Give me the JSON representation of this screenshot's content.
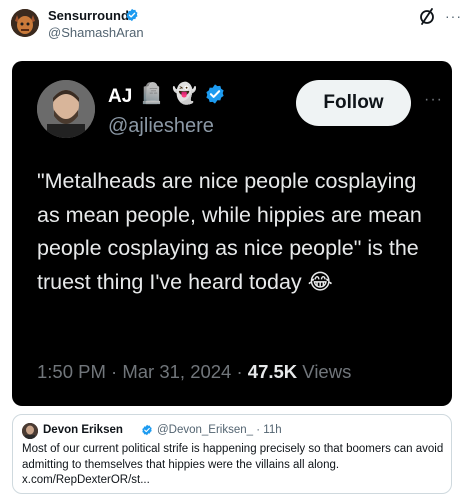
{
  "post": {
    "author_name": "Sensurround",
    "author_handle": "@ShamashAran",
    "verified_badge_icon": "verified-badge-icon",
    "grok_icon": "grok-slash-icon",
    "more_icon": "more-dots-icon",
    "more_glyph": "···"
  },
  "media": {
    "author_name": "AJ",
    "emoji_1": "🪦",
    "emoji_2": "👻",
    "author_handle": "@ajlieshere",
    "follow_label": "Follow",
    "more_glyph": "···",
    "quote_text": "\"Metalheads are nice people cosplaying as mean people, while hippies are mean people cosplaying as nice people\" is the truest thing I've heard today 😂",
    "time": "1:50 PM · Mar 31, 2024 · ",
    "views_count": "47.5K",
    "views_label": " Views"
  },
  "quote": {
    "author_name": "Devon Eriksen",
    "author_handle": "@Devon_Eriksen_ · 11h",
    "text": "Most of our current political strife is happening precisely so that boomers can avoid admitting to themselves that hippies were the villains all along. x.com/RepDexterOR/st..."
  },
  "colors": {
    "verified": "#1d9bf0",
    "media_bg": "#000000",
    "follow_bg": "#eff3f4"
  }
}
